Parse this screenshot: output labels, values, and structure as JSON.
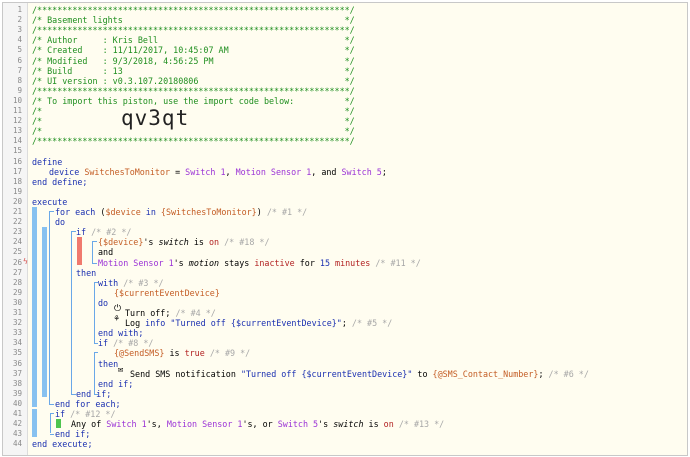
{
  "header_comment": [
    "/**************************************************************/",
    "/* Basement lights                                            */",
    "/**************************************************************/",
    "/* Author     : Kris Bell                                     */",
    "/* Created    : 11/11/2017, 10:45:07 AM                       */",
    "/* Modified   : 9/3/2018, 4:56:25 PM                          */",
    "/* Build      : 13                                            */",
    "/* UI version : v0.3.107.20180806                             */",
    "/**************************************************************/",
    "/* To import this piston, use the import code below:          */",
    "/*                                                            */",
    "/*                                                            */",
    "/*                                                            */",
    "/**************************************************************/"
  ],
  "import_code": "qv3qt",
  "line_numbers": [
    "1",
    "2",
    "3",
    "4",
    "5",
    "6",
    "7",
    "8",
    "9",
    "10",
    "11",
    "12",
    "13",
    "14",
    "15",
    "16",
    "17",
    "18",
    "19",
    "20",
    "21",
    "22",
    "23",
    "24",
    "25",
    "26",
    "27",
    "28",
    "29",
    "30",
    "31",
    "32",
    "33",
    "34",
    "35",
    "36",
    "37",
    "38",
    "39",
    "40",
    "41",
    "42",
    "43",
    "44"
  ],
  "code": {
    "define": "define",
    "device_kw": "device",
    "var_switches": "SwitchesToMonitor",
    "eq": " = ",
    "switch1": "Switch 1",
    "comma": ", ",
    "motion1": "Motion Sensor 1",
    "and_word": ", and ",
    "switch5": "Switch 5",
    "semicolon": ";",
    "end_define": "end define;",
    "execute": "execute",
    "for_each": "for each",
    "device_var": "$device",
    "in_kw": "in",
    "switches_ref": "{SwitchesToMonitor}",
    "c1": "/* #1 */",
    "do": "do",
    "if": "if",
    "c2": "/* #2 */",
    "device_expr": "{$device}",
    "s_switch": "'s ",
    "switch_attr": "switch",
    "is_kw": " is ",
    "on_val": "on",
    "c18": "/* #18 */",
    "and_op": "and",
    "motion_attr": "motion",
    "stays_kw": " stays ",
    "inactive_val": "inactive",
    "for_kw": " for ",
    "fifteen": "15",
    "minutes": "minutes",
    "c11": "/* #11 */",
    "then": "then",
    "with": "with",
    "c3": "/* #3 */",
    "current_event_device": "{$currentEventDevice}",
    "turn_off": "Turn off;",
    "c4": "/* #4 */",
    "log_prefix": "Log ",
    "log_info": "info",
    "log_msg": "\"Turned off {$currentEventDevice}\"",
    "c5": "/* #5 */",
    "end_with": "end with;",
    "c8": "/* #8 */",
    "send_sms_var": "{@SendSMS}",
    "is_word": " is ",
    "true_val": "true",
    "c9": "/* #9 */",
    "sms_prefix": "Send SMS notification ",
    "sms_msg": "\"Turned off {$currentEventDevice}\"",
    "to_kw": " to ",
    "sms_contact": "{@SMS_Contact_Number}",
    "c6": "/* #6 */",
    "end_if": "end if;",
    "end_for_each": "end for each;",
    "c12": "/* #12 */",
    "any_of": "Any of ",
    "s_apos": "'s, ",
    "or_word": "'s, or ",
    "s_switch2": "'s ",
    "c13": "/* #13 */",
    "end_execute": "end execute;"
  },
  "icons": {
    "power": "power-icon",
    "bug": "bug-icon",
    "sms": "speech-bubble-icon",
    "marker": "lightning-bolt-icon"
  },
  "colors": {
    "keyword": "#1a2fb0",
    "device": "#9b33d6",
    "variable": "#c45d25",
    "comment": "#a7a7a7",
    "header_comment": "#1f8f1f",
    "value": "#b22222",
    "bar_blue": "#87c1f0",
    "bar_red": "#f07a6e",
    "bar_green": "#4ec44e"
  }
}
